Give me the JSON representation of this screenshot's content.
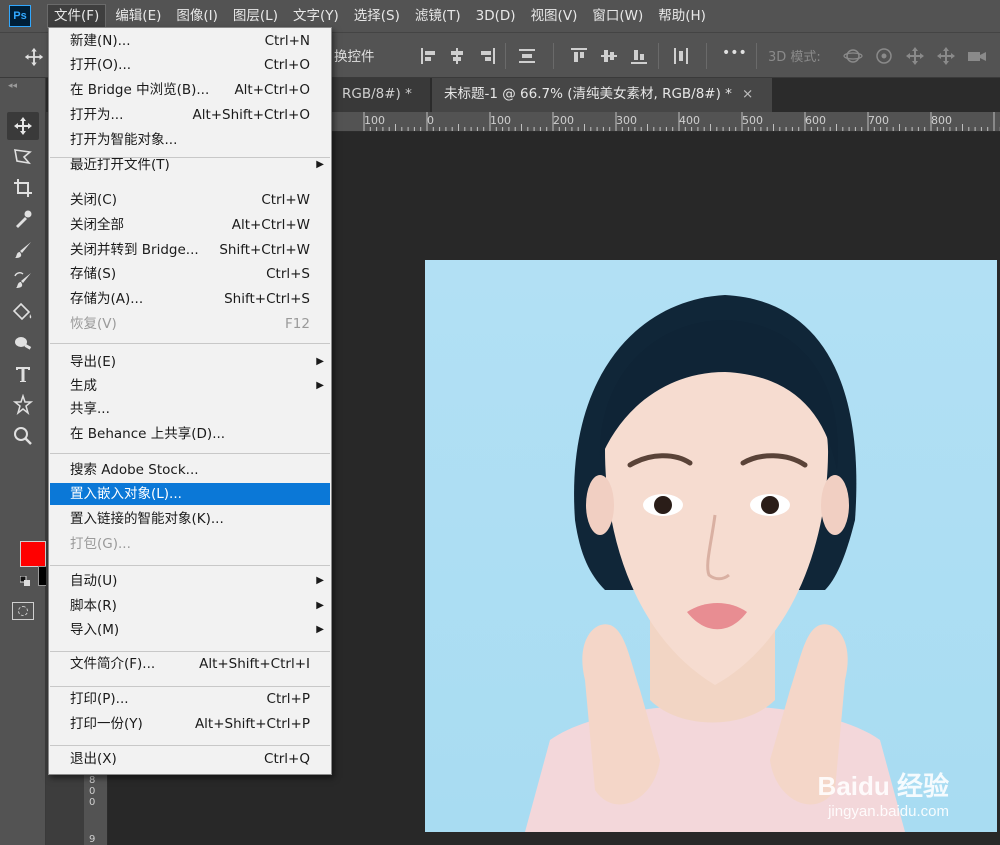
{
  "app": {
    "logo": "Ps",
    "menu": [
      "文件(F)",
      "编辑(E)",
      "图像(I)",
      "图层(L)",
      "文字(Y)",
      "选择(S)",
      "滤镜(T)",
      "3D(D)",
      "视图(V)",
      "窗口(W)",
      "帮助(H)"
    ]
  },
  "options_bar": {
    "transform_label": "换控件",
    "mode_3d": "3D 模式:",
    "more": "•••"
  },
  "tabs": [
    {
      "label": "RGB/8#) *",
      "close": "×"
    },
    {
      "label": "未标题-1 @ 66.7% (清纯美女素材, RGB/8#) *",
      "close": "×"
    }
  ],
  "ruler": {
    "top": [
      "100",
      "0",
      "100",
      "200",
      "300",
      "400",
      "500",
      "600",
      "700",
      "800"
    ],
    "left": [
      "8",
      "0",
      "0",
      "9"
    ]
  },
  "colors": {
    "foreground": "#ff0000",
    "background": "#000000",
    "highlight": "#0b78d7"
  },
  "file_menu": [
    {
      "label": "新建(N)...",
      "shortcut": "Ctrl+N"
    },
    {
      "label": "打开(O)...",
      "shortcut": "Ctrl+O"
    },
    {
      "label": "在 Bridge 中浏览(B)...",
      "shortcut": "Alt+Ctrl+O"
    },
    {
      "label": "打开为...",
      "shortcut": "Alt+Shift+Ctrl+O"
    },
    {
      "label": "打开为智能对象...",
      "shortcut": ""
    },
    {
      "label": "最近打开文件(T)",
      "shortcut": "",
      "submenu": "▶"
    },
    {
      "label": "关闭(C)",
      "shortcut": "Ctrl+W"
    },
    {
      "label": "关闭全部",
      "shortcut": "Alt+Ctrl+W"
    },
    {
      "label": "关闭并转到 Bridge...",
      "shortcut": "Shift+Ctrl+W"
    },
    {
      "label": "存储(S)",
      "shortcut": "Ctrl+S"
    },
    {
      "label": "存储为(A)...",
      "shortcut": "Shift+Ctrl+S"
    },
    {
      "label": "恢复(V)",
      "shortcut": "F12"
    },
    {
      "label": "导出(E)",
      "shortcut": "",
      "submenu": "▶"
    },
    {
      "label": "生成",
      "shortcut": "",
      "submenu": "▶"
    },
    {
      "label": "共享...",
      "shortcut": ""
    },
    {
      "label": "在 Behance 上共享(D)...",
      "shortcut": ""
    },
    {
      "label": "搜索 Adobe Stock...",
      "shortcut": ""
    },
    {
      "label": "置入嵌入对象(L)...",
      "shortcut": ""
    },
    {
      "label": "置入链接的智能对象(K)...",
      "shortcut": ""
    },
    {
      "label": "打包(G)...",
      "shortcut": ""
    },
    {
      "label": "自动(U)",
      "shortcut": "",
      "submenu": "▶"
    },
    {
      "label": "脚本(R)",
      "shortcut": "",
      "submenu": "▶"
    },
    {
      "label": "导入(M)",
      "shortcut": "",
      "submenu": "▶"
    },
    {
      "label": "文件简介(F)...",
      "shortcut": "Alt+Shift+Ctrl+I"
    },
    {
      "label": "打印(P)...",
      "shortcut": "Ctrl+P"
    },
    {
      "label": "打印一份(Y)",
      "shortcut": "Alt+Shift+Ctrl+P"
    },
    {
      "label": "退出(X)",
      "shortcut": "Ctrl+Q"
    }
  ],
  "watermark": {
    "top": "Baidu 经验",
    "bottom": "jingyan.baidu.com"
  }
}
